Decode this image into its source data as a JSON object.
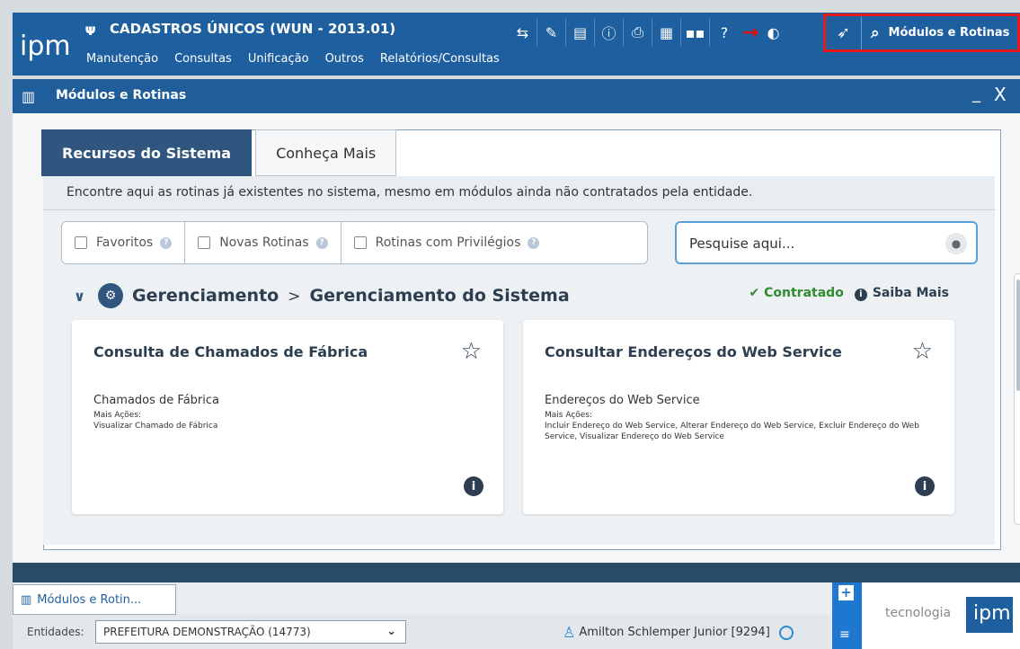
{
  "app": {
    "logo": "ipm",
    "title": "CADASTROS ÚNICOS (WUN - 2013.01)",
    "menu": [
      "Manutenção",
      "Consultas",
      "Unificação",
      "Outros",
      "Relatórios/Consultas"
    ]
  },
  "toolbar": {
    "icons": [
      "share-icon",
      "pen-icon",
      "document-icon",
      "info-icon",
      "printer-icon",
      "calendar-icon",
      "grid-icon",
      "help-icon",
      "theme-icon"
    ],
    "modules_button": "Módulos e Rotinas"
  },
  "window": {
    "title": "Módulos e Rotinas",
    "minimize": "_",
    "close": "X"
  },
  "tabs": [
    {
      "label": "Recursos do Sistema",
      "active": true
    },
    {
      "label": "Conheça Mais",
      "active": false
    }
  ],
  "info_text": "Encontre aqui as rotinas já existentes no sistema, mesmo em módulos ainda não contratados pela entidade.",
  "filters": [
    {
      "label": "Favoritos",
      "checked": false
    },
    {
      "label": "Novas Rotinas",
      "checked": false
    },
    {
      "label": "Rotinas com Privilégios",
      "checked": false
    }
  ],
  "search": {
    "placeholder": "Pesquise aqui...",
    "value": ""
  },
  "section": {
    "module": "Gerenciamento",
    "separator": ">",
    "submodule": "Gerenciamento do Sistema",
    "status": "Contratado",
    "more": "Saiba Mais"
  },
  "cards": [
    {
      "title": "Consulta de Chamados de Fábrica",
      "subtitle": "Chamados de Fábrica",
      "more_label": "Mais Ações:",
      "actions": "Visualizar Chamado de Fábrica"
    },
    {
      "title": "Consultar Endereços do Web Service",
      "subtitle": "Endereços do Web Service",
      "more_label": "Mais Ações:",
      "actions": "Incluir Endereço do Web Service, Alterar Endereço do Web Service, Excluir Endereço do Web Service, Visualizar Endereço do Web Service"
    }
  ],
  "taskbar": {
    "item": "Módulos e Rotin..."
  },
  "status": {
    "entities_label": "Entidades:",
    "entity": "PREFEITURA DEMONSTRAÇÃO (14773)",
    "user": "Amilton Schlemper Junior [9294]",
    "brand_text": "tecnologia",
    "brand_logo": "ipm"
  },
  "colors": {
    "primary": "#1e5f9f",
    "tab_active": "#30557e",
    "highlight": "#e41b1b",
    "contratado": "#2e8b2e"
  }
}
